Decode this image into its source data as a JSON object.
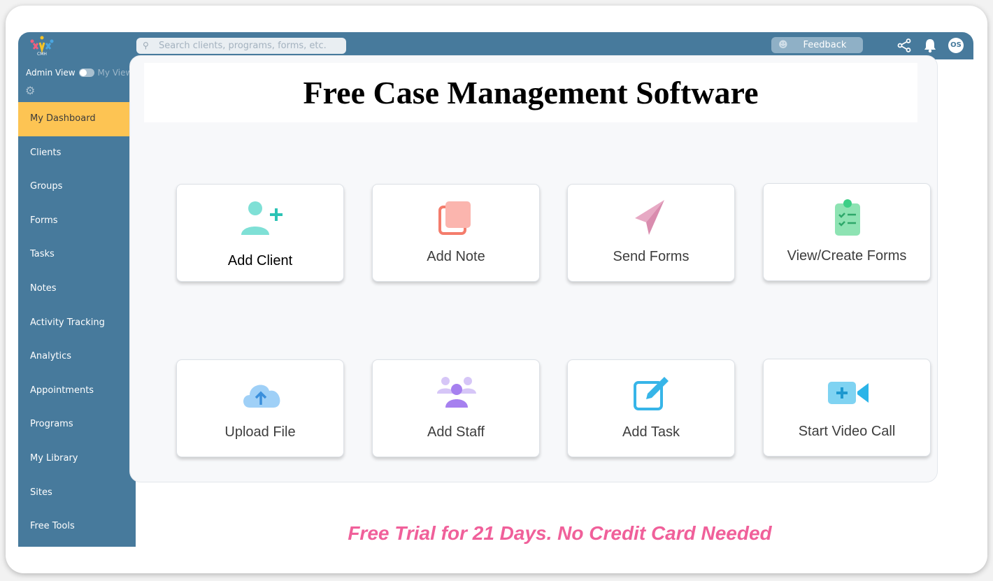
{
  "header": {
    "logo_text": "CMH",
    "search_placeholder": "Search clients, programs, forms, etc.",
    "feedback_label": "Feedback",
    "avatar_initials": "OS"
  },
  "sidebar": {
    "admin_view": "Admin View",
    "my_view": "My View",
    "items": [
      {
        "label": "My Dashboard",
        "active": true
      },
      {
        "label": "Clients"
      },
      {
        "label": "Groups"
      },
      {
        "label": "Forms"
      },
      {
        "label": "Tasks"
      },
      {
        "label": "Notes"
      },
      {
        "label": "Activity Tracking"
      },
      {
        "label": "Analytics"
      },
      {
        "label": "Appointments"
      },
      {
        "label": "Programs"
      },
      {
        "label": "My Library"
      },
      {
        "label": "Sites"
      },
      {
        "label": "Free Tools"
      }
    ]
  },
  "main": {
    "title": "Free Case Management Software",
    "tiles": [
      {
        "label": "Add Client",
        "icon": "add-user-icon"
      },
      {
        "label": "Add Note",
        "icon": "note-icon"
      },
      {
        "label": "Send Forms",
        "icon": "paper-plane-icon"
      },
      {
        "label": "View/Create Forms",
        "icon": "clipboard-icon"
      },
      {
        "label": "Upload File",
        "icon": "cloud-upload-icon"
      },
      {
        "label": "Add Staff",
        "icon": "staff-icon"
      },
      {
        "label": "Add Task",
        "icon": "edit-icon"
      },
      {
        "label": "Start Video Call",
        "icon": "video-icon"
      }
    ]
  },
  "footer": {
    "text": "Free Trial for 21 Days. No Credit Card Needed"
  },
  "colors": {
    "header": "#477a9c",
    "active": "#fdc453",
    "footer_text": "#f0609a"
  }
}
